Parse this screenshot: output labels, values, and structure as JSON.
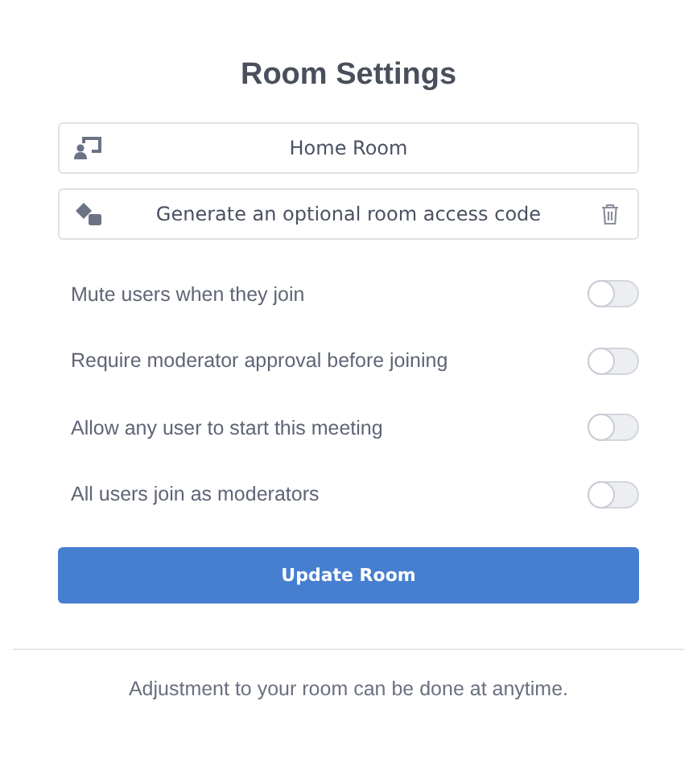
{
  "title": "Room Settings",
  "name_field": {
    "value": "Home Room"
  },
  "access_code_field": {
    "placeholder": "Generate an optional room access code"
  },
  "toggles": [
    {
      "label": "Mute users when they join",
      "on": false
    },
    {
      "label": "Require moderator approval before joining",
      "on": false
    },
    {
      "label": "Allow any user to start this meeting",
      "on": false
    },
    {
      "label": "All users join as moderators",
      "on": false
    }
  ],
  "submit_button": "Update Room",
  "footer": "Adjustment to your room can be done at anytime."
}
